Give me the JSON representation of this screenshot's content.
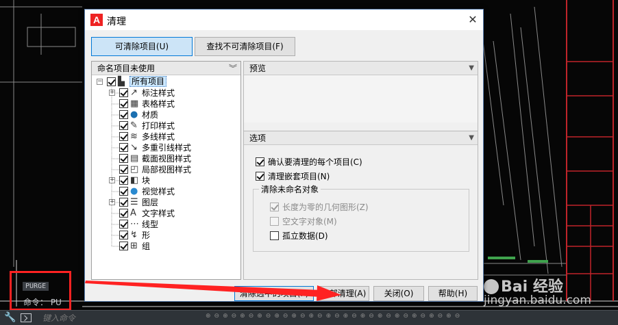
{
  "background": {
    "command_history": "PURGE",
    "command_line": "命令： PU",
    "command_prompt_placeholder": "键入命令",
    "watermark_logo": "Bai 经验",
    "watermark_url": "jingyan.baidu.com"
  },
  "dialog": {
    "title": "清理",
    "tabs": [
      {
        "label": "可清除项目(U)",
        "active": true
      },
      {
        "label": "查找不可清除项目(F)",
        "active": false
      }
    ],
    "tree_header": "命名项目未使用",
    "tree": [
      {
        "label": "所有项目",
        "checked": true,
        "expandable": true,
        "icon": "all-items-icon",
        "level": 0
      },
      {
        "label": "标注样式",
        "checked": true,
        "expandable": true,
        "icon": "dimension-style-icon",
        "level": 1
      },
      {
        "label": "表格样式",
        "checked": true,
        "expandable": false,
        "icon": "table-style-icon",
        "level": 1
      },
      {
        "label": "材质",
        "checked": true,
        "expandable": false,
        "icon": "material-icon",
        "level": 1
      },
      {
        "label": "打印样式",
        "checked": true,
        "expandable": false,
        "icon": "plot-style-icon",
        "level": 1
      },
      {
        "label": "多线样式",
        "checked": true,
        "expandable": false,
        "icon": "multiline-style-icon",
        "level": 1
      },
      {
        "label": "多重引线样式",
        "checked": true,
        "expandable": false,
        "icon": "multileader-style-icon",
        "level": 1
      },
      {
        "label": "截面视图样式",
        "checked": true,
        "expandable": false,
        "icon": "section-view-style-icon",
        "level": 1
      },
      {
        "label": "局部视图样式",
        "checked": true,
        "expandable": false,
        "icon": "detail-view-style-icon",
        "level": 1
      },
      {
        "label": "块",
        "checked": true,
        "expandable": true,
        "icon": "block-icon",
        "level": 1
      },
      {
        "label": "视觉样式",
        "checked": true,
        "expandable": false,
        "icon": "visual-style-icon",
        "level": 1
      },
      {
        "label": "图层",
        "checked": true,
        "expandable": true,
        "icon": "layer-icon",
        "level": 1
      },
      {
        "label": "文字样式",
        "checked": true,
        "expandable": false,
        "icon": "text-style-icon",
        "level": 1
      },
      {
        "label": "线型",
        "checked": true,
        "expandable": false,
        "icon": "linetype-icon",
        "level": 1
      },
      {
        "label": "形",
        "checked": true,
        "expandable": false,
        "icon": "shape-icon",
        "level": 1
      },
      {
        "label": "组",
        "checked": true,
        "expandable": false,
        "icon": "group-icon",
        "level": 1
      }
    ],
    "preview_header": "预览",
    "options_header": "选项",
    "options": {
      "confirm_each": {
        "label": "确认要清理的每个项目(C)",
        "checked": true
      },
      "purge_nested": {
        "label": "清理嵌套项目(N)",
        "checked": true
      },
      "unnamed_group_title": "清除未命名对象",
      "zero_length": {
        "label": "长度为零的几何图形(Z)",
        "checked": true,
        "disabled": true
      },
      "empty_text": {
        "label": "空文字对象(M)",
        "checked": false,
        "disabled": true
      },
      "orphaned_data": {
        "label": "孤立数据(D)",
        "checked": false,
        "disabled": false
      }
    },
    "buttons": {
      "purge_checked": "清除选中的项目(P)",
      "purge_all": "全部清理(A)",
      "close": "关闭(O)",
      "help": "帮助(H)"
    }
  },
  "colors": {
    "annotation_red": "#ff2222",
    "cad_frame_red": "#c0242a",
    "active_tab": "#cce4f7"
  }
}
